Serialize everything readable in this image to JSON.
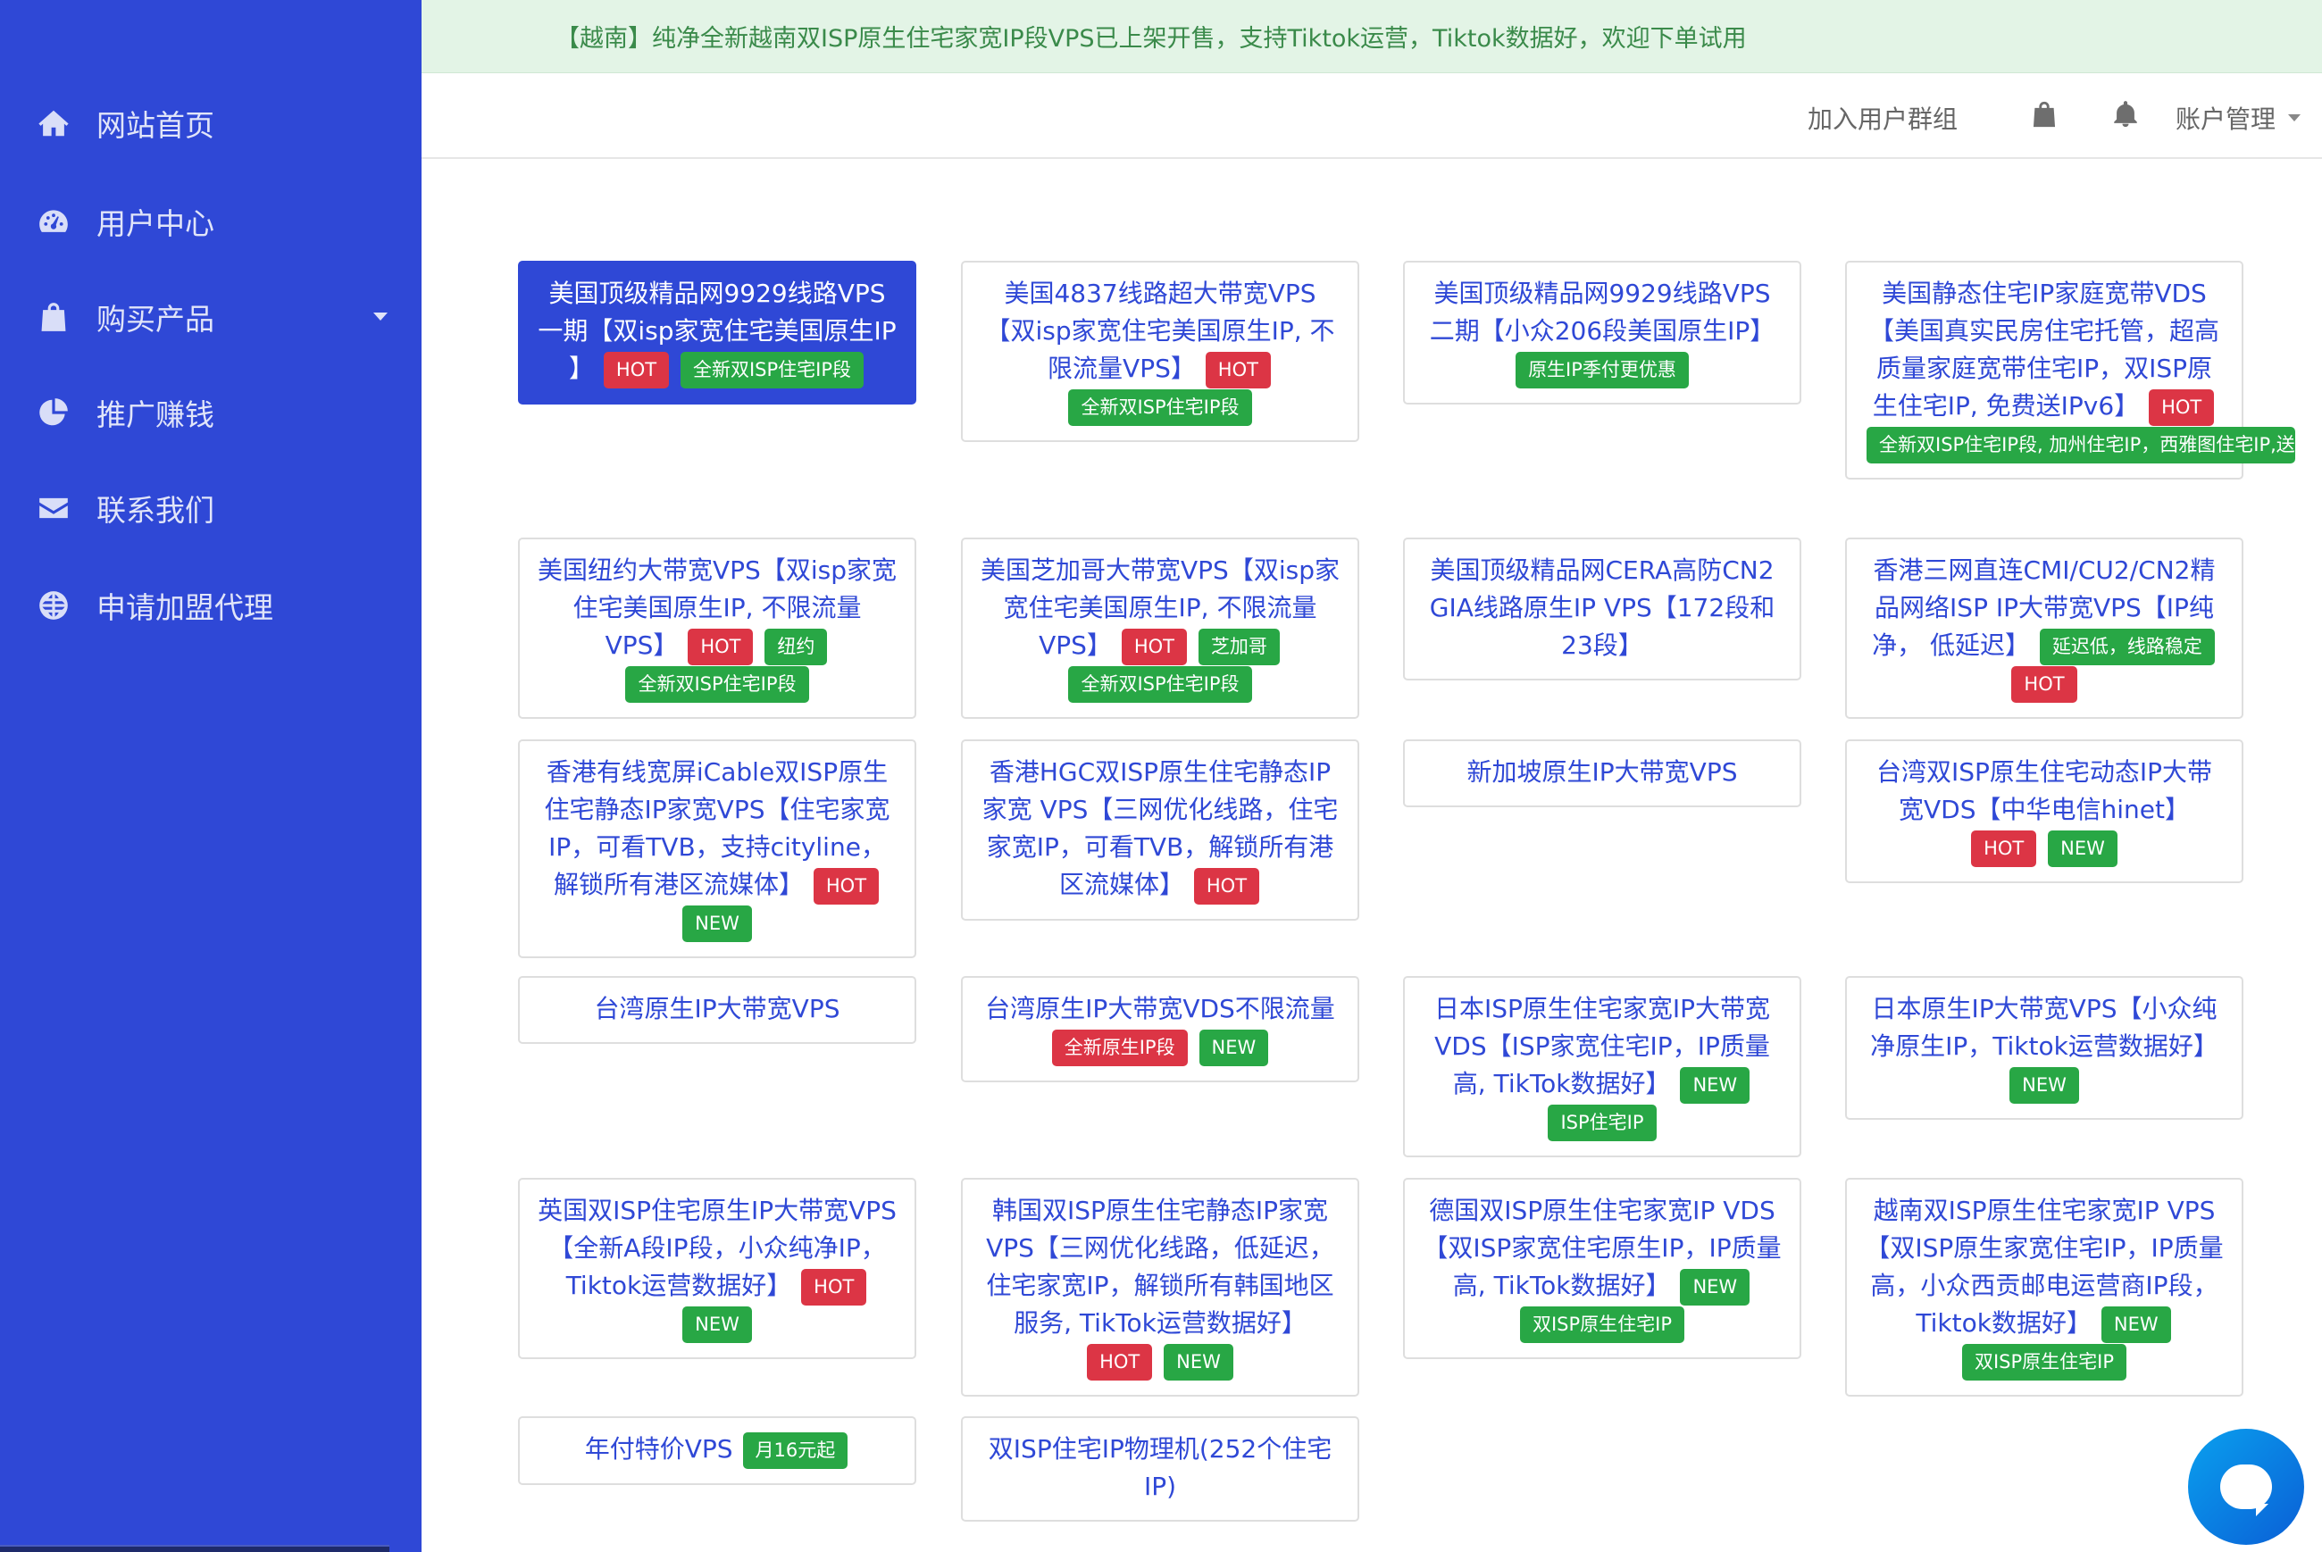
{
  "announcement": "【越南】纯净全新越南双ISP原生住宅家宽IP段VPS已上架开售，支持Tiktok运营，Tiktok数据好，欢迎下单试用",
  "sidebar": {
    "items": [
      {
        "label": "网站首页",
        "icon": "home-icon"
      },
      {
        "label": "用户中心",
        "icon": "dashboard-icon"
      },
      {
        "label": "购买产品",
        "icon": "shopping-bag-icon"
      },
      {
        "label": "推广赚钱",
        "icon": "pie-chart-icon"
      },
      {
        "label": "联系我们",
        "icon": "envelope-icon"
      },
      {
        "label": "申请加盟代理",
        "icon": "globe-icon"
      }
    ]
  },
  "topbar": {
    "join_group": "加入用户群组",
    "cart_icon": "shopping-bag-icon",
    "bell_icon": "bell-icon",
    "account": "账户管理"
  },
  "products": [
    {
      "title": "美国顶级精品网9929线路VPS一期【双isp家宽住宅美国原生IP 】",
      "badges": [
        {
          "text": "HOT",
          "color": "red"
        },
        {
          "text": "全新双ISP住宅IP段",
          "color": "green"
        }
      ],
      "active": true
    },
    {
      "title": "美国4837线路超大带宽VPS【双isp家宽住宅美国原生IP, 不限流量VPS】",
      "badges": [
        {
          "text": "HOT",
          "color": "red"
        },
        {
          "text": "全新双ISP住宅IP段",
          "color": "green"
        }
      ]
    },
    {
      "title": "美国顶级精品网9929线路VPS二期【小众206段美国原生IP】",
      "badges": [
        {
          "text": "原生IP季付更优惠",
          "color": "green"
        }
      ]
    },
    {
      "title": "美国静态住宅IP家庭宽带VDS【美国真实民房住宅托管，超高质量家庭宽带住宅IP，双ISP原生住宅IP, 免费送IPv6】",
      "badges": [
        {
          "text": "HOT",
          "color": "red"
        },
        {
          "text": "全新双ISP住宅IP段, 加州住宅IP，西雅图住宅IP,送I",
          "color": "green"
        }
      ]
    },
    {
      "title": "美国纽约大带宽VPS【双isp家宽住宅美国原生IP, 不限流量VPS】",
      "badges": [
        {
          "text": "HOT",
          "color": "red"
        },
        {
          "text": "纽约",
          "color": "green"
        },
        {
          "text": "全新双ISP住宅IP段",
          "color": "green"
        }
      ]
    },
    {
      "title": "美国芝加哥大带宽VPS【双isp家宽住宅美国原生IP, 不限流量VPS】",
      "badges": [
        {
          "text": "HOT",
          "color": "red"
        },
        {
          "text": "芝加哥",
          "color": "green"
        },
        {
          "text": "全新双ISP住宅IP段",
          "color": "green"
        }
      ]
    },
    {
      "title": "美国顶级精品网CERA高防CN2 GIA线路原生IP VPS【172段和23段】",
      "badges": []
    },
    {
      "title": "香港三网直连CMI/CU2/CN2精品网络ISP IP大带宽VPS【IP纯净， 低延迟】",
      "badges": [
        {
          "text": "延迟低，线路稳定",
          "color": "green"
        },
        {
          "text": "HOT",
          "color": "red"
        }
      ]
    },
    {
      "title": "香港有线宽屏iCable双ISP原生住宅静态IP家宽VPS【住宅家宽IP，可看TVB，支持cityline，解锁所有港区流媒体】",
      "badges": [
        {
          "text": "HOT",
          "color": "red"
        },
        {
          "text": "NEW",
          "color": "green"
        }
      ]
    },
    {
      "title": "香港HGC双ISP原生住宅静态IP家宽 VPS【三网优化线路，住宅家宽IP，可看TVB，解锁所有港区流媒体】",
      "badges": [
        {
          "text": "HOT",
          "color": "red"
        }
      ]
    },
    {
      "title": "新加坡原生IP大带宽VPS",
      "badges": []
    },
    {
      "title": "台湾双ISP原生住宅动态IP大带宽VDS【中华电信hinet】",
      "badges": [
        {
          "text": "HOT",
          "color": "red"
        },
        {
          "text": "NEW",
          "color": "green"
        }
      ]
    },
    {
      "title": "台湾原生IP大带宽VPS",
      "badges": []
    },
    {
      "title": "台湾原生IP大带宽VDS不限流量",
      "badges": [
        {
          "text": "全新原生IP段",
          "color": "red"
        },
        {
          "text": "NEW",
          "color": "green"
        }
      ]
    },
    {
      "title": "日本ISP原生住宅家宽IP大带宽VDS【ISP家宽住宅IP，IP质量高, TikTok数据好】",
      "badges": [
        {
          "text": "NEW",
          "color": "green"
        },
        {
          "text": "ISP住宅IP",
          "color": "green"
        }
      ]
    },
    {
      "title": "日本原生IP大带宽VPS【小众纯净原生IP，Tiktok运营数据好】",
      "badges": [
        {
          "text": "NEW",
          "color": "green"
        }
      ]
    },
    {
      "title": "英国双ISP住宅原生IP大带宽VPS【全新A段IP段，小众纯净IP，Tiktok运营数据好】",
      "badges": [
        {
          "text": "HOT",
          "color": "red"
        },
        {
          "text": "NEW",
          "color": "green"
        }
      ]
    },
    {
      "title": "韩国双ISP原生住宅静态IP家宽VPS【三网优化线路，低延迟，住宅家宽IP，解锁所有韩国地区服务, TikTok运营数据好】",
      "badges": [
        {
          "text": "HOT",
          "color": "red"
        },
        {
          "text": "NEW",
          "color": "green"
        }
      ]
    },
    {
      "title": "德国双ISP原生住宅家宽IP VDS【双ISP家宽住宅原生IP，IP质量高, TikTok数据好】",
      "badges": [
        {
          "text": "NEW",
          "color": "green"
        },
        {
          "text": "双ISP原生住宅IP",
          "color": "green"
        }
      ]
    },
    {
      "title": "越南双ISP原生住宅家宽IP VPS【双ISP原生家宽住宅IP，IP质量高，小众西贡邮电运营商IP段，Tiktok数据好】",
      "badges": [
        {
          "text": "NEW",
          "color": "green"
        },
        {
          "text": "双ISP原生住宅IP",
          "color": "green"
        }
      ]
    },
    {
      "title": "年付特价VPS",
      "badges": [
        {
          "text": "月16元起",
          "color": "green"
        }
      ]
    },
    {
      "title": "双ISP住宅IP物理机(252个住宅IP)",
      "badges": []
    }
  ],
  "colors": {
    "sidebar": "#2f48d6",
    "hot_badge": "#dc3545",
    "new_badge": "#28a745",
    "announcement_bg": "#e3f4e6"
  }
}
